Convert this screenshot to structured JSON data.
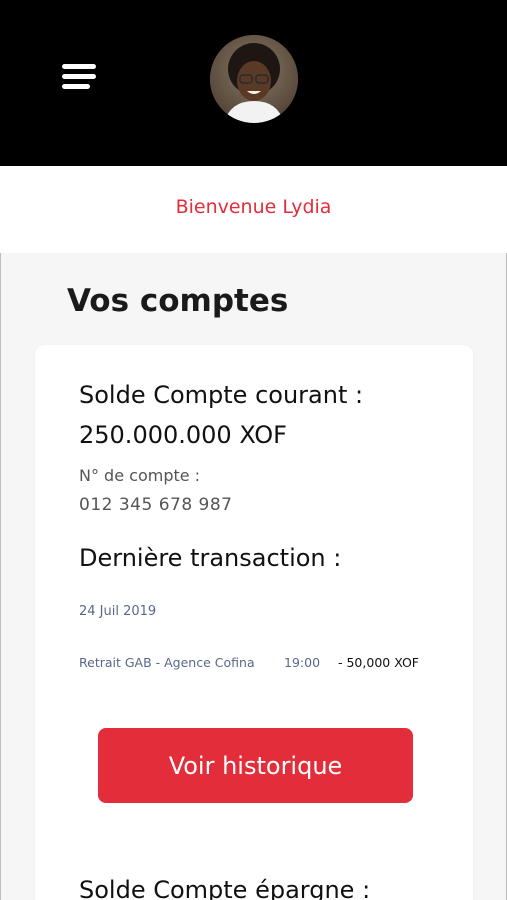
{
  "header": {
    "menu_icon": "hamburger-menu-icon",
    "avatar_icon": "user-avatar"
  },
  "welcome": "Bienvenue Lydia",
  "accounts": {
    "title": "Vos comptes",
    "current": {
      "balance_label": "Solde Compte courant :",
      "balance_value": "250.000.000 XOF",
      "account_number_label": "N° de compte :",
      "account_number": "012 345 678 987"
    },
    "last_transaction": {
      "title": "Dernière transaction :",
      "date": "24 Juil 2019",
      "description": "Retrait GAB - Agence Cofina",
      "time": "19:00",
      "amount": "- 50,000 XOF"
    },
    "history_button": "Voir historique",
    "savings_label": "Solde Compte épargne :"
  },
  "colors": {
    "accent": "#e32d3a",
    "header_bg": "#000000",
    "muted_text": "#59688a"
  }
}
